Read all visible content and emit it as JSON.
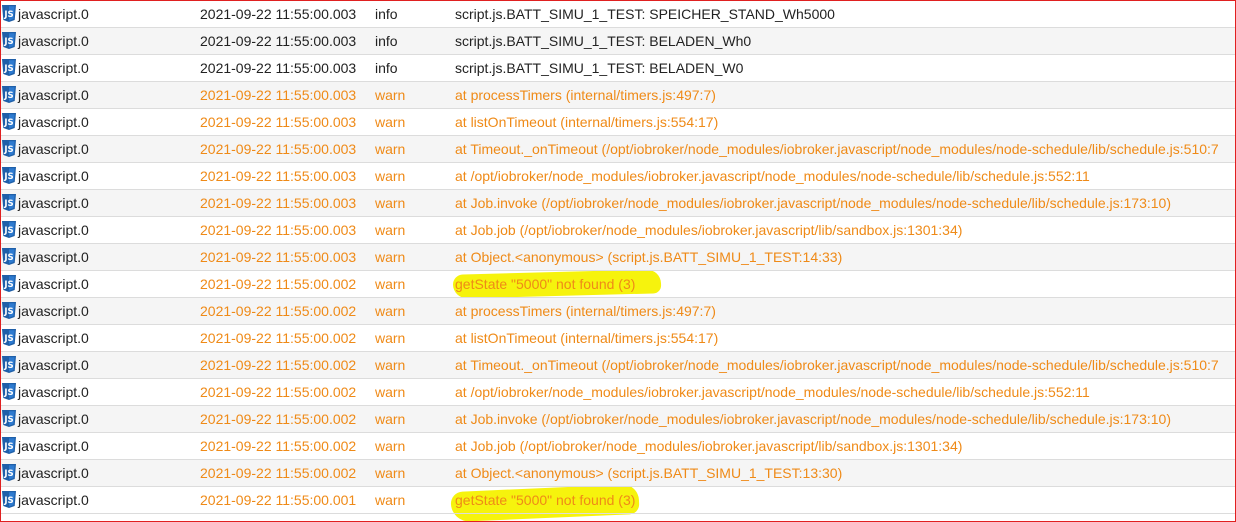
{
  "log": {
    "rows": [
      {
        "source": "javascript.0",
        "time": "2021-09-22 11:55:00.003",
        "severity": "info",
        "message": "script.js.BATT_SIMU_1_TEST: SPEICHER_STAND_Wh5000"
      },
      {
        "source": "javascript.0",
        "time": "2021-09-22 11:55:00.003",
        "severity": "info",
        "message": "script.js.BATT_SIMU_1_TEST: BELADEN_Wh0"
      },
      {
        "source": "javascript.0",
        "time": "2021-09-22 11:55:00.003",
        "severity": "info",
        "message": "script.js.BATT_SIMU_1_TEST: BELADEN_W0"
      },
      {
        "source": "javascript.0",
        "time": "2021-09-22 11:55:00.003",
        "severity": "warn",
        "message": "at processTimers (internal/timers.js:497:7)"
      },
      {
        "source": "javascript.0",
        "time": "2021-09-22 11:55:00.003",
        "severity": "warn",
        "message": "at listOnTimeout (internal/timers.js:554:17)"
      },
      {
        "source": "javascript.0",
        "time": "2021-09-22 11:55:00.003",
        "severity": "warn",
        "message": "at Timeout._onTimeout (/opt/iobroker/node_modules/iobroker.javascript/node_modules/node-schedule/lib/schedule.js:510:7"
      },
      {
        "source": "javascript.0",
        "time": "2021-09-22 11:55:00.003",
        "severity": "warn",
        "message": "at /opt/iobroker/node_modules/iobroker.javascript/node_modules/node-schedule/lib/schedule.js:552:11"
      },
      {
        "source": "javascript.0",
        "time": "2021-09-22 11:55:00.003",
        "severity": "warn",
        "message": "at Job.invoke (/opt/iobroker/node_modules/iobroker.javascript/node_modules/node-schedule/lib/schedule.js:173:10)"
      },
      {
        "source": "javascript.0",
        "time": "2021-09-22 11:55:00.003",
        "severity": "warn",
        "message": "at Job.job (/opt/iobroker/node_modules/iobroker.javascript/lib/sandbox.js:1301:34)"
      },
      {
        "source": "javascript.0",
        "time": "2021-09-22 11:55:00.003",
        "severity": "warn",
        "message": "at Object.<anonymous> (script.js.BATT_SIMU_1_TEST:14:33)"
      },
      {
        "source": "javascript.0",
        "time": "2021-09-22 11:55:00.002",
        "severity": "warn",
        "message": "getState \"5000\" not found (3)"
      },
      {
        "source": "javascript.0",
        "time": "2021-09-22 11:55:00.002",
        "severity": "warn",
        "message": "at processTimers (internal/timers.js:497:7)"
      },
      {
        "source": "javascript.0",
        "time": "2021-09-22 11:55:00.002",
        "severity": "warn",
        "message": "at listOnTimeout (internal/timers.js:554:17)"
      },
      {
        "source": "javascript.0",
        "time": "2021-09-22 11:55:00.002",
        "severity": "warn",
        "message": "at Timeout._onTimeout (/opt/iobroker/node_modules/iobroker.javascript/node_modules/node-schedule/lib/schedule.js:510:7"
      },
      {
        "source": "javascript.0",
        "time": "2021-09-22 11:55:00.002",
        "severity": "warn",
        "message": "at /opt/iobroker/node_modules/iobroker.javascript/node_modules/node-schedule/lib/schedule.js:552:11"
      },
      {
        "source": "javascript.0",
        "time": "2021-09-22 11:55:00.002",
        "severity": "warn",
        "message": "at Job.invoke (/opt/iobroker/node_modules/iobroker.javascript/node_modules/node-schedule/lib/schedule.js:173:10)"
      },
      {
        "source": "javascript.0",
        "time": "2021-09-22 11:55:00.002",
        "severity": "warn",
        "message": "at Job.job (/opt/iobroker/node_modules/iobroker.javascript/lib/sandbox.js:1301:34)"
      },
      {
        "source": "javascript.0",
        "time": "2021-09-22 11:55:00.002",
        "severity": "warn",
        "message": "at Object.<anonymous> (script.js.BATT_SIMU_1_TEST:13:30)"
      },
      {
        "source": "javascript.0",
        "time": "2021-09-22 11:55:00.001",
        "severity": "warn",
        "message": "getState \"5000\" not found (3)"
      }
    ]
  },
  "colors": {
    "info_text": "#222222",
    "warn_text": "#ef8a17",
    "highlight": "#f6f200",
    "border": "#e02020",
    "js_icon": "#1f5fa8"
  },
  "icons": {
    "source_icon": "javascript-adapter-icon"
  }
}
